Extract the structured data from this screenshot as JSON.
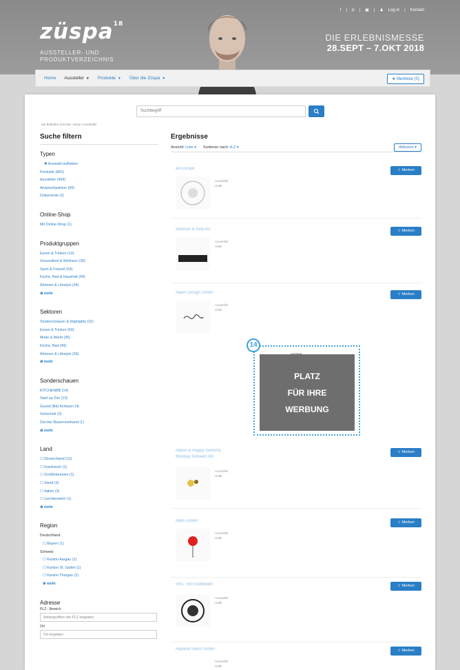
{
  "header": {
    "logo": "züspa",
    "logo_sup": "18",
    "subtitle_line1": "AUSSTELLER- UND",
    "subtitle_line2": "PRODUKTVERZEICHNIS",
    "event_line1": "DIE ERLEBNISMESSE",
    "event_line2": "28.SEPT – 7.OKT 2018",
    "top_links": [
      "Log in",
      "Kontakt"
    ]
  },
  "nav": {
    "items": [
      "Home",
      "Aussteller",
      "Produkte",
      "Über die Züspa"
    ],
    "merkliste": "Merkliste (0)"
  },
  "search": {
    "placeholder": "Suchbegriff"
  },
  "breadcrumb": "Sie befinden sich hier:  Home  /  Aussteller",
  "sidebar": {
    "title": "Suche filtern",
    "typen": {
      "title": "Typen",
      "items": [
        "Auswahl aufheben",
        "Produkte (862)",
        "Aussteller (469)",
        "Ansprechpartner (60)",
        "Dokumente (2)"
      ]
    },
    "shop": {
      "title": "Online-Shop",
      "items": [
        "Mit Online-Shop (1)"
      ]
    },
    "produktgruppen": {
      "title": "Produktgruppen",
      "items": [
        "Essen & Trinken (10)",
        "Gesundheit & Wellness (39)",
        "Sport & Freizeit (53)",
        "Küche, Bad & Haushalt (94)",
        "Wohnen & Lifestyle (34)",
        "mehr"
      ]
    },
    "sektoren": {
      "title": "Sektoren",
      "items": [
        "Sonderschauen & Highlights (15)",
        "Essen & Trinken (60)",
        "Mode & Markt (35)",
        "Küche, Bad (49)",
        "Wohnen & Lifestyle (26)",
        "mehr"
      ]
    },
    "sonderschauen": {
      "title": "Sonderschauen",
      "items": [
        "KITCHENBB (14)",
        "Start up Züri (13)",
        "Gsund (Bd) Achtsam (4)",
        "Sicherheit (3)",
        "Zürcher Bauernverband (1)",
        "mehr"
      ]
    },
    "land": {
      "title": "Land",
      "items": [
        "Deutschland (12)",
        "Frankreich (1)",
        "Großbritannien (1)",
        "Irland (3)",
        "Italien (3)",
        "Liechtenstein (1)",
        "mehr"
      ]
    },
    "region": {
      "title": "Region",
      "de": "Deutschland",
      "de_items": [
        "Bayern (1)"
      ],
      "ch": "Schweiz",
      "ch_items": [
        "Kanton Aargau (1)",
        "Kanton St. Gallen (1)",
        "Kanton Thurgau (1)",
        "mehr"
      ]
    },
    "adresse": {
      "title": "Adresse",
      "plz_label": "PLZ - Bereich",
      "plz_placeholder": "Anfangsziffern der PLZ eingeben",
      "ort_label": "Ort",
      "ort_placeholder": "Ort eingeben"
    }
  },
  "results": {
    "title": "Ergebnisse",
    "ansicht_label": "Ansicht:",
    "ansicht_value": "Liste",
    "sort_label": "Sortieren nach:",
    "sort_value": "A-Z",
    "alpha_button": "Aktionen",
    "merken_label": "☆ Merken",
    "cards": [
      {
        "name": "ad Europe",
        "info": "Aussteller Halle"
      },
      {
        "name": "Adresse & Asia AG",
        "info": "Aussteller Halle"
      },
      {
        "name": "Alpen Design GmbH",
        "info": "Aussteller Halle"
      },
      {
        "name": "Alpine & Happy Swimmy Monday Schweiz AG",
        "info": "Aussteller Halle"
      },
      {
        "name": "Apex GmbH",
        "info": "Aussteller Halle"
      },
      {
        "name": "ARC Test Südländer",
        "info": "Aussteller Halle"
      },
      {
        "name": "Aquaria Swiss GmbH",
        "info": "Aussteller Halle"
      }
    ],
    "ad_label": "Anzeige",
    "ad_lines": [
      "PLATZ",
      "FÜR IHRE",
      "WERBUNG"
    ],
    "ad_badge": "14"
  },
  "colors": {
    "accent": "#2a7ec6",
    "ad_outline": "#3ea0e0",
    "ad_fill": "#6e6e6e"
  }
}
